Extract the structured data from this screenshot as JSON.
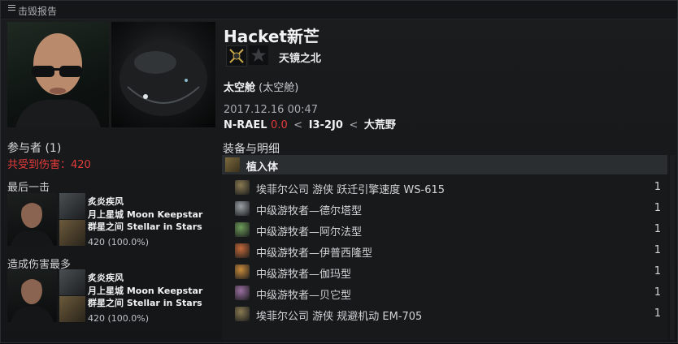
{
  "window": {
    "title": "击毁报告"
  },
  "victim": {
    "name": "Hacket新芒",
    "alliance": "天镜之北",
    "ship_name": "太空舱",
    "ship_type": "(太空舱)",
    "datetime": "2017.12.16 00:47",
    "system": "N-RAEL",
    "security": "0.0",
    "constellation": "I3-2J0",
    "region": "大荒野",
    "separator": "<"
  },
  "participants": {
    "label": "参与者 (1)",
    "damage_taken": "共受到伤害：420"
  },
  "final_blow": {
    "label": "最后一击",
    "name": "炙炎疾风",
    "corp": "月上星城 Moon Keepstar",
    "alliance": "群星之间 Stellar in Stars",
    "damage": "420 (100.0%)"
  },
  "top_damage": {
    "label": "造成伤害最多",
    "name": "炙炎疾风",
    "corp": "月上星城 Moon Keepstar",
    "alliance": "群星之间 Stellar in Stars",
    "damage": "420 (100.0%)"
  },
  "fittings": {
    "title": "装备与明细",
    "group": "植入体",
    "items": [
      {
        "name": "埃菲尔公司 游侠 跃迁引擎速度 WS-615",
        "qty": "1",
        "icon": "implant-icon",
        "color": "#8a7a52"
      },
      {
        "name": "中级游牧者—德尔塔型",
        "qty": "1",
        "icon": "nomad-delta-icon",
        "color": "#9aa0a6"
      },
      {
        "name": "中级游牧者—阿尔法型",
        "qty": "1",
        "icon": "nomad-alpha-icon",
        "color": "#6e9c5a"
      },
      {
        "name": "中级游牧者—伊普西隆型",
        "qty": "1",
        "icon": "nomad-epsilon-icon",
        "color": "#c46a3a"
      },
      {
        "name": "中级游牧者—伽玛型",
        "qty": "1",
        "icon": "nomad-gamma-icon",
        "color": "#c98b3c"
      },
      {
        "name": "中级游牧者—贝它型",
        "qty": "1",
        "icon": "nomad-beta-icon",
        "color": "#9a6fa0"
      },
      {
        "name": "埃菲尔公司 游侠 规避机动 EM-705",
        "qty": "1",
        "icon": "implant-icon",
        "color": "#8a7a52"
      }
    ]
  }
}
